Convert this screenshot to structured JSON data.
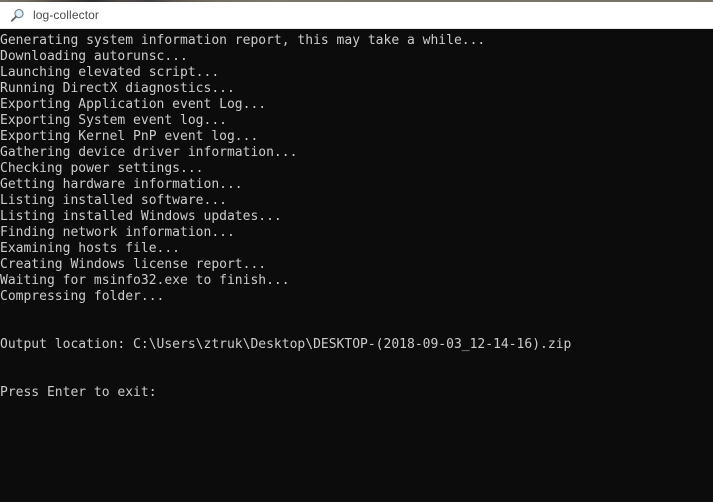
{
  "window": {
    "title": "log-collector",
    "title_icon": "magnifier-icon",
    "title_bar_bg": "#ffffff",
    "title_text_color": "#4a4a4a"
  },
  "console": {
    "background_color": "#0c0c0c",
    "text_color": "#cccccc",
    "lines": [
      "Generating system information report, this may take a while...",
      "Downloading autorunsc...",
      "Launching elevated script...",
      "Running DirectX diagnostics...",
      "Exporting Application event Log...",
      "Exporting System event log...",
      "Exporting Kernel PnP event log...",
      "Gathering device driver information...",
      "Checking power settings...",
      "Getting hardware information...",
      "Listing installed software...",
      "Listing installed Windows updates...",
      "Finding network information...",
      "Examining hosts file...",
      "Creating Windows license report...",
      "Waiting for msinfo32.exe to finish...",
      "Compressing folder...",
      "",
      "",
      "Output location: C:\\Users\\ztruk\\Desktop\\DESKTOP-(2018-09-03_12-14-16).zip",
      "",
      "",
      "Press Enter to exit:"
    ]
  }
}
